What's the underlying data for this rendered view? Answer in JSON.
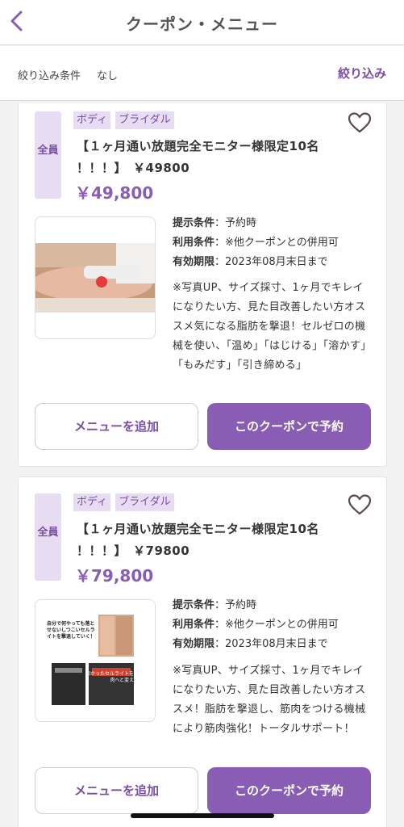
{
  "header": {
    "title": "クーポン・メニュー"
  },
  "filter": {
    "label": "絞り込み条件",
    "value": "なし",
    "button": "絞り込み"
  },
  "coupons": [
    {
      "side_tag": "全員",
      "tags": [
        "ボディ",
        "ブライダル"
      ],
      "title_line1": "【１ヶ月通い放題完全モニター様限定10名",
      "title_line2": "！！！】　￥49800",
      "price": "￥49,800",
      "conditions": [
        {
          "key": "提示条件",
          "value": "：予約時"
        },
        {
          "key": "利用条件",
          "value": "：※他クーポンとの併用可"
        },
        {
          "key": "有効期限",
          "value": "：2023年08月末日まで"
        }
      ],
      "description": "※写真UP、サイズ採寸、1ヶ月でキレイになりたい方、見た目改善したい方オススメ気になる脂肪を撃退！セルゼロの機械を使い、「温め」「はじける」「溶かす」「もみだす」「引き締める」",
      "add_button": "メニューを追加",
      "reserve_button": "このクーポンで予約"
    },
    {
      "side_tag": "全員",
      "tags": [
        "ボディ",
        "ブライダル"
      ],
      "title_line1": "【１ヶ月通い放題完全モニター様限定10名",
      "title_line2": "！！！】　￥79800",
      "price": "￥79,800",
      "conditions": [
        {
          "key": "提示条件",
          "value": "：予約時"
        },
        {
          "key": "利用条件",
          "value": "：※他クーポンとの併用可"
        },
        {
          "key": "有効期限",
          "value": "：2023年08月末日まで"
        }
      ],
      "description": "※写真UP、サイズ採寸、1ヶ月でキレイになりたい方、見た目改善したい方オススメ！脂肪を撃退し、筋肉をつける機械により筋肉強化！トータルサポート！",
      "flyer_text_1": "自分で何やっても落とせないしつこいセルライトを撃退していく！",
      "flyer_text_2": "固かったセルライトを筋肉へと変える",
      "add_button": "メニューを追加",
      "reserve_button": "このクーポンで予約"
    }
  ],
  "colors": {
    "accent": "#8a5db5",
    "accent_text": "#7a4fa3",
    "tag_bg": "#e8dcf2"
  }
}
